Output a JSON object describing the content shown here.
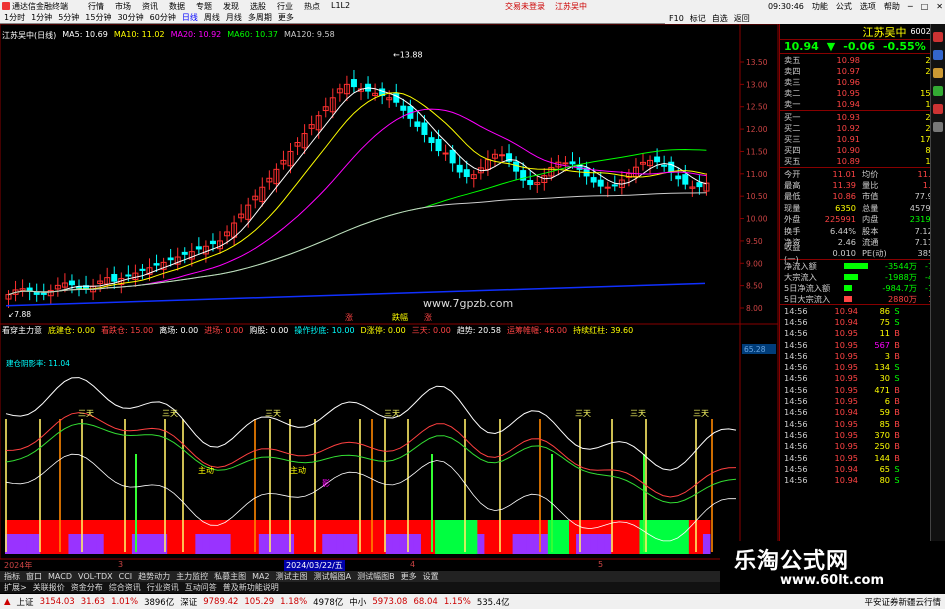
{
  "titlebar": {
    "app": "通达信金融终端",
    "menu": [
      "行情",
      "市场",
      "资讯",
      "数据",
      "专题",
      "发现",
      "选股",
      "行业",
      "热点",
      "L1L2"
    ],
    "center": [
      "交易未登录",
      "江苏吴中"
    ],
    "clock": "09:30:46",
    "right": [
      "功能",
      "公式",
      "选项",
      "帮助"
    ]
  },
  "periodbar": [
    "1分时",
    "1分钟",
    "5分钟",
    "15分钟",
    "30分钟",
    "60分钟",
    "日线",
    "周线",
    "月线",
    "多周期",
    "更多"
  ],
  "period_selected": "日线",
  "rtoolbar": [
    "F10",
    "标记",
    "自选",
    "返回"
  ],
  "chart_info": {
    "name": "江苏吴中(日线)",
    "ma5": "MA5: 10.69",
    "ma10": "MA10: 11.02",
    "ma20": "MA20: 10.92",
    "ma60": "MA60: 10.37",
    "ma120": "MA120: 9.58"
  },
  "high_label": "13.88",
  "low_label": "7.88",
  "price_axis": [
    "13.50",
    "13.00",
    "12.50",
    "12.00",
    "11.50",
    "11.00",
    "10.50",
    "10.00",
    "9.50",
    "9.00",
    "8.50",
    "8.00"
  ],
  "candle_tags": [
    "涨",
    "跌幅",
    "涨"
  ],
  "watermark_center": "www.7gpzb.com",
  "indicator_info": {
    "name": "看穿主力意",
    "items": [
      {
        "t": "底建仓: 0.00",
        "c": "#ff0"
      },
      {
        "t": "看跌仓: 15.00",
        "c": "#f44"
      },
      {
        "t": "离场: 0.00",
        "c": "#fff"
      },
      {
        "t": "进场: 0.00",
        "c": "#f44"
      },
      {
        "t": "购股: 0.00",
        "c": "#fff"
      },
      {
        "t": "操作抄底: 10.00",
        "c": "#0ff"
      },
      {
        "t": "D涨停: 0.00",
        "c": "#ff0"
      },
      {
        "t": "三天: 0.00",
        "c": "#f44"
      },
      {
        "t": "趋势: 20.58",
        "c": "#fff"
      },
      {
        "t": "运筹帷幄: 46.00",
        "c": "#f44"
      },
      {
        "t": "持续红柱: 39.60",
        "c": "#ff0"
      }
    ],
    "sub": "建仓阴影率: 11.04"
  },
  "ind_tags": [
    "三天",
    "三天",
    "三天",
    "三天",
    "三天",
    "三天",
    "三天"
  ],
  "ind_labels": [
    {
      "t": "主动",
      "c": "#ff0"
    },
    {
      "t": "主动",
      "c": "#ff0"
    },
    {
      "t": "影",
      "c": "#f0f"
    }
  ],
  "ind_axis_value": "65.28",
  "stock": {
    "name": "江苏吴中",
    "code": "600200"
  },
  "price": {
    "last": "10.94",
    "arrow": "▼",
    "change": "-0.06",
    "pct": "-0.55%"
  },
  "asks": [
    {
      "l": "卖五",
      "p": "10.98",
      "v": "220"
    },
    {
      "l": "卖四",
      "p": "10.97",
      "v": "239"
    },
    {
      "l": "卖三",
      "p": "10.96",
      "v": "53"
    },
    {
      "l": "卖二",
      "p": "10.95",
      "v": "1568"
    },
    {
      "l": "卖一",
      "p": "10.94",
      "v": "126"
    }
  ],
  "bids": [
    {
      "l": "买一",
      "p": "10.93",
      "v": "244"
    },
    {
      "l": "买二",
      "p": "10.92",
      "v": "244"
    },
    {
      "l": "买三",
      "p": "10.91",
      "v": "1759"
    },
    {
      "l": "买四",
      "p": "10.90",
      "v": "844"
    },
    {
      "l": "买五",
      "p": "10.89",
      "v": "167"
    }
  ],
  "quotes": [
    {
      "a": "今开",
      "b": "11.01",
      "bc": "#f44",
      "c": "均价",
      "d": "11.13",
      "dc": "#f44"
    },
    {
      "a": "最高",
      "b": "11.39",
      "bc": "#f44",
      "c": "量比",
      "d": "1.35",
      "dc": "#f44"
    },
    {
      "a": "最低",
      "b": "10.86",
      "bc": "#f44",
      "c": "市值",
      "d": "77.9亿",
      "dc": "#ccc"
    },
    {
      "a": "现量",
      "b": "6350",
      "bc": "#ff0",
      "c": "总量",
      "d": "457975",
      "dc": "#ccc"
    },
    {
      "a": "外盘",
      "b": "225991",
      "bc": "#f44",
      "c": "内盘",
      "d": "231984",
      "dc": "#0f0"
    },
    {
      "a": "换手",
      "b": "6.44%",
      "bc": "#ccc",
      "c": "股本",
      "d": "7.12亿",
      "dc": "#ccc"
    },
    {
      "a": "净资",
      "b": "2.46",
      "bc": "#ccc",
      "c": "流通",
      "d": "7.11亿",
      "dc": "#ccc"
    },
    {
      "a": "收益(一)",
      "b": "0.010",
      "bc": "#ccc",
      "c": "PE(动)",
      "d": "385.1",
      "dc": "#ccc"
    }
  ],
  "flows": [
    {
      "n": "净流入额",
      "v": "-3544万",
      "vc": "#0f0",
      "pct": "-7%",
      "bar_frac": 0.6,
      "bc": "#0f0"
    },
    {
      "n": "大宗流入",
      "v": "-1988万",
      "vc": "#0f0",
      "pct": "-4%",
      "bar_frac": 0.35,
      "bc": "#0f0"
    },
    {
      "n": "5日净流入额",
      "v": "-984.7万",
      "vc": "#0f0",
      "pct": "-1%",
      "bar_frac": 0.2,
      "bc": "#0f0"
    },
    {
      "n": "5日大宗流入",
      "v": "2880万",
      "vc": "#f44",
      "pct": "1%",
      "bar_frac": 0.2,
      "bc": "#f44"
    }
  ],
  "ticks": [
    {
      "t": "14:56",
      "p": "10.94",
      "v": "86",
      "s": "S",
      "sc": "#0f0",
      "n": "5"
    },
    {
      "t": "14:56",
      "p": "10.94",
      "v": "75",
      "s": "S",
      "sc": "#0f0",
      "n": "6"
    },
    {
      "t": "14:56",
      "p": "10.95",
      "v": "11",
      "s": "B",
      "sc": "#f44",
      "n": "2"
    },
    {
      "t": "14:56",
      "p": "10.95",
      "v": "567",
      "s": "B",
      "sc": "#f44",
      "n": "14"
    },
    {
      "t": "14:56",
      "p": "10.95",
      "v": "3",
      "s": "B",
      "sc": "#f44",
      "n": "1"
    },
    {
      "t": "14:56",
      "p": "10.95",
      "v": "134",
      "s": "S",
      "sc": "#0f0",
      "n": "3"
    },
    {
      "t": "14:56",
      "p": "10.95",
      "v": "30",
      "s": "S",
      "sc": "#0f0",
      "n": "5"
    },
    {
      "t": "14:56",
      "p": "10.95",
      "v": "471",
      "s": "B",
      "sc": "#f44",
      "n": "8"
    },
    {
      "t": "14:56",
      "p": "10.95",
      "v": "6",
      "s": "B",
      "sc": "#f44",
      "n": "2"
    },
    {
      "t": "14:56",
      "p": "10.94",
      "v": "59",
      "s": "B",
      "sc": "#f44",
      "n": "6"
    },
    {
      "t": "14:56",
      "p": "10.95",
      "v": "85",
      "s": "B",
      "sc": "#f44",
      "n": "4"
    },
    {
      "t": "14:56",
      "p": "10.95",
      "v": "370",
      "s": "B",
      "sc": "#f44",
      "n": "6"
    },
    {
      "t": "14:56",
      "p": "10.95",
      "v": "250",
      "s": "B",
      "sc": "#f44",
      "n": "6"
    },
    {
      "t": "14:56",
      "p": "10.95",
      "v": "144",
      "s": "B",
      "sc": "#f44",
      "n": "6"
    },
    {
      "t": "14:56",
      "p": "10.94",
      "v": "65",
      "s": "S",
      "sc": "#0f0",
      "n": "5"
    },
    {
      "t": "14:56",
      "p": "10.94",
      "v": "80",
      "s": "S",
      "sc": "#0f0",
      "n": "5"
    }
  ],
  "datebar": {
    "year": "2024年",
    "m3": "3",
    "selected": "2024/03/22/五",
    "m4": "4",
    "m5": "5"
  },
  "bottom_tabs": [
    "指标",
    "窗口",
    "MACD",
    "VOL-TDX",
    "CCI",
    "趋势动力",
    "主力监控",
    "私募主图",
    "MA2",
    "测试主图",
    "测试幅图A",
    "测试幅图B",
    "更多",
    "设置"
  ],
  "bottom_tabs2": [
    "扩展>",
    "关联报价",
    "资金分布",
    "综合资讯",
    "行业资讯",
    "互动问答",
    "普及新功能说明"
  ],
  "statusbar": {
    "idx1": "上证",
    "idx1_v": "3154.03",
    "idx1_c": "31.63",
    "idx1_p": "1.01%",
    "idx1_a": "3896亿",
    "idx2": "深证",
    "idx2_v": "9789.42",
    "idx2_c": "105.29",
    "idx2_p": "1.18%",
    "idx2_a": "4978亿",
    "idx3": "中小",
    "idx3_v": "5973.08",
    "idx3_c": "68.04",
    "idx3_p": "1.15%",
    "idx3_a": "535.4亿",
    "broker": "平安证券新疆云行情"
  },
  "watermark": {
    "t1": "乐淘公式网",
    "t2": "www.60lt.com"
  },
  "colors": {
    "up": "#ff3030",
    "down": "#00ffff",
    "bg": "#000000",
    "frame": "#800000"
  }
}
